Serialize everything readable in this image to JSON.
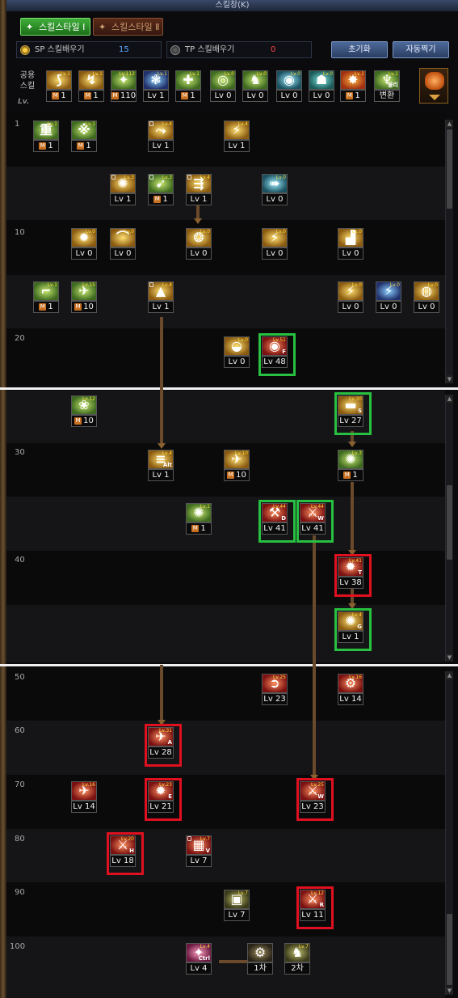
{
  "window": {
    "title": "스킬창(K)"
  },
  "tabs": [
    {
      "label": "스킬스타일 Ⅰ"
    },
    {
      "label": "스킬스타일 Ⅱ"
    }
  ],
  "points": {
    "sp": {
      "label": "SP 스킬배우기",
      "value": "15"
    },
    "tp": {
      "label": "TP 스킬배우기",
      "value": "0"
    }
  },
  "buttons": {
    "reset": "초기화",
    "auto": "자동찍기"
  },
  "shared": {
    "label": "공용 스킬",
    "lv_label": "Lv.",
    "skills": [
      {
        "footer": "1",
        "mastery": true,
        "tag": "Lv.1",
        "glyph": "⟆",
        "theme": "t-gold"
      },
      {
        "footer": "1",
        "mastery": true,
        "tag": "Lv.1",
        "glyph": "↯",
        "theme": "t-gold"
      },
      {
        "footer": "110",
        "mastery": true,
        "tag": "Lv.112",
        "glyph": "✦",
        "theme": "t-green"
      },
      {
        "footer": "Lv 1",
        "mastery": false,
        "tag": "Lv.1",
        "glyph": "❃",
        "theme": "t-blue"
      },
      {
        "footer": "1",
        "mastery": true,
        "tag": "Lv.1",
        "glyph": "✚",
        "theme": "t-green"
      },
      {
        "footer": "Lv 0",
        "mastery": false,
        "tag": "Lv.0",
        "glyph": "◎",
        "theme": "t-green"
      },
      {
        "footer": "Lv 0",
        "mastery": false,
        "tag": "Lv.0",
        "glyph": "♞",
        "theme": "t-green"
      },
      {
        "footer": "Lv 0",
        "mastery": false,
        "tag": "Lv.0",
        "glyph": "◉",
        "theme": "t-cyan"
      },
      {
        "footer": "Lv 0",
        "mastery": false,
        "tag": "Lv.0",
        "glyph": "☗",
        "theme": "t-teal"
      },
      {
        "footer": "1",
        "mastery": true,
        "tag": "Lv.1",
        "glyph": "✸",
        "theme": "t-orange"
      },
      {
        "footer": "변환",
        "mastery": false,
        "tag": "Lv.1",
        "glyph": "♆",
        "theme": "t-green",
        "hotkey": "물리"
      }
    ]
  },
  "tree": {
    "level_labels": [
      "1",
      "10",
      "20",
      "30",
      "40",
      "50",
      "60",
      "70",
      "80",
      "90",
      "100"
    ],
    "skills": [
      {
        "footer": "1",
        "mastery": true,
        "tag": "Lv.1",
        "glyph": "重",
        "theme": "t-green"
      },
      {
        "footer": "1",
        "mastery": true,
        "tag": "Lv.1",
        "glyph": "※",
        "theme": "t-green"
      },
      {
        "footer": "Lv 1",
        "mastery": false,
        "tag": "Lv.4",
        "glyph": "⤳",
        "theme": "t-gold",
        "lock": true
      },
      {
        "footer": "Lv 1",
        "mastery": false,
        "tag": "Lv.4",
        "glyph": "⚡",
        "theme": "t-gold"
      },
      {
        "footer": "Lv 1",
        "mastery": false,
        "tag": "Lv.3",
        "glyph": "✺",
        "theme": "t-gold",
        "lock": true
      },
      {
        "footer": "1",
        "mastery": true,
        "tag": "Lv.3",
        "glyph": "➹",
        "theme": "t-green",
        "lock": true
      },
      {
        "footer": "Lv 1",
        "mastery": false,
        "tag": "Lv.4",
        "glyph": "⇶",
        "theme": "t-gold",
        "lock": true
      },
      {
        "footer": "Lv 0",
        "mastery": false,
        "tag": "Lv.0",
        "glyph": "➠",
        "theme": "t-cyan"
      },
      {
        "footer": "Lv 0",
        "mastery": false,
        "tag": "Lv.0",
        "glyph": "✹",
        "theme": "t-gold"
      },
      {
        "footer": "Lv 0",
        "mastery": false,
        "tag": "Lv.0",
        "glyph": "⌒",
        "theme": "t-gold"
      },
      {
        "footer": "Lv 0",
        "mastery": false,
        "tag": "Lv.0",
        "glyph": "❂",
        "theme": "t-gold"
      },
      {
        "footer": "Lv 0",
        "mastery": false,
        "tag": "Lv.0",
        "glyph": "⚡",
        "theme": "t-gold"
      },
      {
        "footer": "Lv 0",
        "mastery": false,
        "tag": "Lv.0",
        "glyph": "▟",
        "theme": "t-gold"
      },
      {
        "footer": "1",
        "mastery": true,
        "tag": "Lv.1",
        "glyph": "⌐",
        "theme": "t-green"
      },
      {
        "footer": "10",
        "mastery": true,
        "tag": "Lv.15",
        "glyph": "✈",
        "theme": "t-green"
      },
      {
        "footer": "Lv 1",
        "mastery": false,
        "tag": "Lv.4",
        "glyph": "▲",
        "theme": "t-gold",
        "lock": true
      },
      {
        "footer": "Lv 0",
        "mastery": false,
        "tag": "Lv.0",
        "glyph": "⚡",
        "theme": "t-gold"
      },
      {
        "footer": "Lv 0",
        "mastery": false,
        "tag": "Lv.0",
        "glyph": "⚡",
        "theme": "t-blue"
      },
      {
        "footer": "Lv 0",
        "mastery": false,
        "tag": "Lv.0",
        "glyph": "◍",
        "theme": "t-gold"
      },
      {
        "footer": "Lv 0",
        "mastery": false,
        "tag": "Lv.0",
        "glyph": "◒",
        "theme": "t-gold"
      },
      {
        "footer": "Lv 48",
        "mastery": false,
        "tag": "Lv.51",
        "glyph": "◉",
        "theme": "t-red",
        "highlight": "green",
        "hotkey": "F"
      },
      {
        "footer": "10",
        "mastery": true,
        "tag": "Lv.12",
        "glyph": "❀",
        "theme": "t-green"
      },
      {
        "footer": "Lv 27",
        "mastery": false,
        "tag": "Lv.30",
        "glyph": "▬",
        "theme": "t-gold",
        "highlight": "green",
        "hotkey": "S"
      },
      {
        "footer": "Lv 1",
        "mastery": false,
        "tag": "Lv.4",
        "glyph": "≡",
        "theme": "t-gold",
        "hotkey": "Alt"
      },
      {
        "footer": "10",
        "mastery": true,
        "tag": "Lv.10",
        "glyph": "✈",
        "theme": "t-gold"
      },
      {
        "footer": "1",
        "mastery": true,
        "tag": "Lv.3",
        "glyph": "✺",
        "theme": "t-green"
      },
      {
        "footer": "1",
        "mastery": true,
        "tag": "Lv.1",
        "glyph": "✺",
        "theme": "t-green"
      },
      {
        "footer": "Lv 41",
        "mastery": false,
        "tag": "Lv.44",
        "glyph": "⚒",
        "theme": "t-red",
        "highlight": "green",
        "hotkey": "D"
      },
      {
        "footer": "Lv 41",
        "mastery": false,
        "tag": "Lv.44",
        "glyph": "⚔",
        "theme": "t-red",
        "highlight": "green",
        "hotkey": "W"
      },
      {
        "footer": "Lv 38",
        "mastery": false,
        "tag": "Lv.41",
        "glyph": "✹",
        "theme": "t-red",
        "highlight": "red",
        "hotkey": "T"
      },
      {
        "footer": "Lv 1",
        "mastery": false,
        "tag": "Lv.4",
        "glyph": "✺",
        "theme": "t-gold",
        "highlight": "green",
        "hotkey": "G"
      },
      {
        "footer": "Lv 23",
        "mastery": false,
        "tag": "Lv.25",
        "glyph": "➲",
        "theme": "t-red"
      },
      {
        "footer": "Lv 14",
        "mastery": false,
        "tag": "Lv.16",
        "glyph": "⚙",
        "theme": "t-red"
      },
      {
        "footer": "Lv 28",
        "mastery": false,
        "tag": "Lv.31",
        "glyph": "✈",
        "theme": "t-red",
        "highlight": "red",
        "hotkey": "A"
      },
      {
        "footer": "Lv 14",
        "mastery": false,
        "tag": "Lv.16",
        "glyph": "✈",
        "theme": "t-red"
      },
      {
        "footer": "Lv 21",
        "mastery": false,
        "tag": "Lv.23",
        "glyph": "✹",
        "theme": "t-red",
        "highlight": "red",
        "hotkey": "E"
      },
      {
        "footer": "Lv 23",
        "mastery": false,
        "tag": "Lv.25",
        "glyph": "⚔",
        "theme": "t-red",
        "highlight": "red",
        "hotkey": "W"
      },
      {
        "footer": "Lv 18",
        "mastery": false,
        "tag": "Lv.20",
        "glyph": "⚔",
        "theme": "t-red",
        "highlight": "red",
        "hotkey": "H"
      },
      {
        "footer": "Lv 7",
        "mastery": false,
        "tag": "Lv.7",
        "glyph": "▦",
        "theme": "t-red",
        "hotkey": "V",
        "lock": true
      },
      {
        "footer": "Lv 7",
        "mastery": false,
        "tag": "Lv.7",
        "glyph": "▣",
        "theme": "t-khaki"
      },
      {
        "footer": "Lv 11",
        "mastery": false,
        "tag": "Lv.12",
        "glyph": "⚔",
        "theme": "t-red",
        "highlight": "red",
        "hotkey": "R"
      },
      {
        "footer": "Lv 4",
        "mastery": false,
        "tag": "Lv.4",
        "glyph": "✦",
        "theme": "t-pink",
        "hotkey": "Ctrl"
      },
      {
        "footer": "1차",
        "mastery": false,
        "tag": "",
        "glyph": "⚙",
        "theme": "t-dark"
      },
      {
        "footer": "2차",
        "mastery": false,
        "tag": "Lv.7",
        "glyph": "♞",
        "theme": "t-khaki"
      }
    ]
  },
  "colors": {
    "highlight_green": "#28c040",
    "highlight_red": "#e01020",
    "tab_active": "#3fae3a",
    "button_blue": "#4d6a9a"
  }
}
